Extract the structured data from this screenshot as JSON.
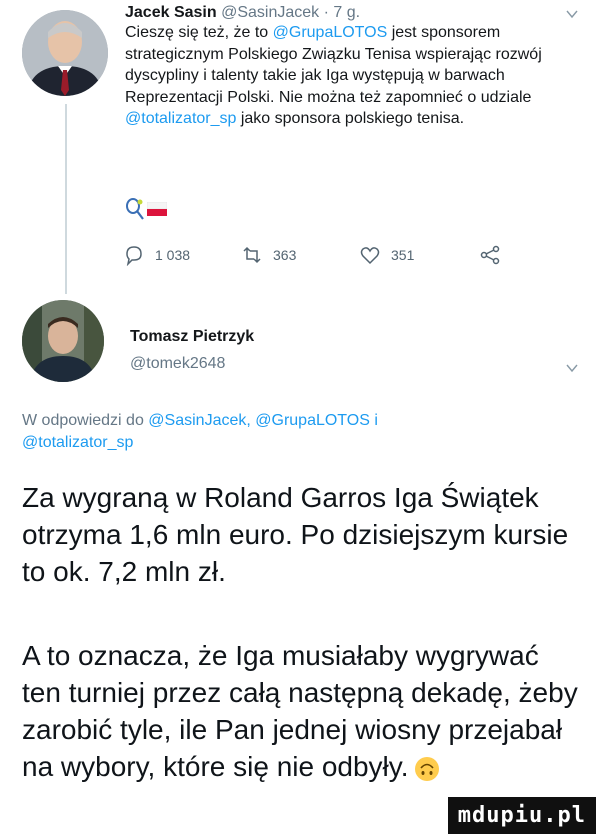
{
  "tweet1": {
    "author_name": "Jacek Sasin",
    "handle": "@SasinJacek",
    "time": "· 7 g.",
    "body_segments": [
      {
        "text": "Cieszę się też, że to ",
        "type": "text"
      },
      {
        "text": "@GrupaLOTOS",
        "type": "link"
      },
      {
        "text": " jest sponsorem strategicznym Polskiego Związku Tenisa wspierając rozwój dyscypliny i talenty takie jak Iga występują w barwach Reprezentacji Polski. Nie można też zapomnieć o udziale ",
        "type": "text"
      },
      {
        "text": "@totalizator_sp",
        "type": "link"
      },
      {
        "text": " jako sponsora polskiego tenisa.",
        "type": "text"
      }
    ],
    "emojis": [
      "tennis-racket-emoji",
      "poland-flag-emoji"
    ],
    "actions": {
      "reply_count": "1 038",
      "retweet_count": "363",
      "like_count": "351"
    }
  },
  "tweet2": {
    "author_name": "Tomasz Pietrzyk",
    "handle": "@tomek2648",
    "reply_prefix": "W odpowiedzi do",
    "reply_handles_1": "@SasinJacek, @GrupaLOTOS i",
    "reply_handles_2": "@totalizator_sp",
    "paragraph1": "Za wygraną w Roland Garros Iga Świątek otrzyma 1,6 mln euro. Po dzisiejszym kursie to ok. 7,2 mln zł.",
    "paragraph2": "A to oznacza, że Iga musiałaby wygrywać ten turniej przez całą następną dekadę, żeby zarobić tyle, ile Pan jednej wiosny przejabał na wybory, które się nie odbyły."
  },
  "watermark": "mdupiu.pl",
  "colors": {
    "link": "#1d9bf0",
    "muted": "#657786",
    "text": "#0f1419"
  }
}
